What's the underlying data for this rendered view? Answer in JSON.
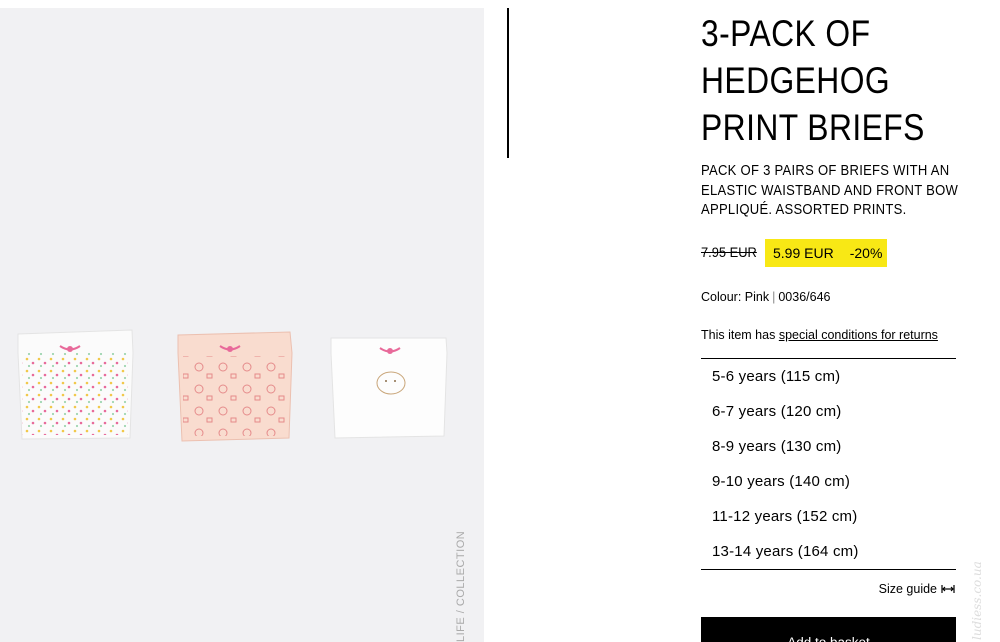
{
  "product": {
    "title_lines": [
      "3-PACK OF",
      "HEDGEHOG",
      "PRINT BRIEFS"
    ],
    "description": "PACK OF 3 PAIRS OF BRIEFS WITH AN ELASTIC WAISTBAND AND FRONT BOW APPLIQUÉ. ASSORTED PRINTS.",
    "old_price": "7.95 EUR",
    "sale_price": "5.99 EUR",
    "discount": "-20%",
    "colour_label": "Colour: Pink",
    "colour_code": "0036/646",
    "returns_prefix": "This item has",
    "returns_link": "special conditions for returns"
  },
  "image_tag": "LIFE / COLLECTION",
  "sizes": [
    "5-6 years (115 cm)",
    "6-7 years (120 cm)",
    "8-9 years (130 cm)",
    "9-10 years (140 cm)",
    "11-12 years (152 cm)",
    "13-14 years (164 cm)"
  ],
  "size_guide": {
    "label": "Size guide",
    "icon": "ruler-arrows-icon"
  },
  "add_to_basket": "Add to basket",
  "watermark": "ludiess.co.ua",
  "colors": {
    "price_highlight": "#f8e815",
    "button_bg": "#000000",
    "photo_bg": "#f1f1f3"
  }
}
